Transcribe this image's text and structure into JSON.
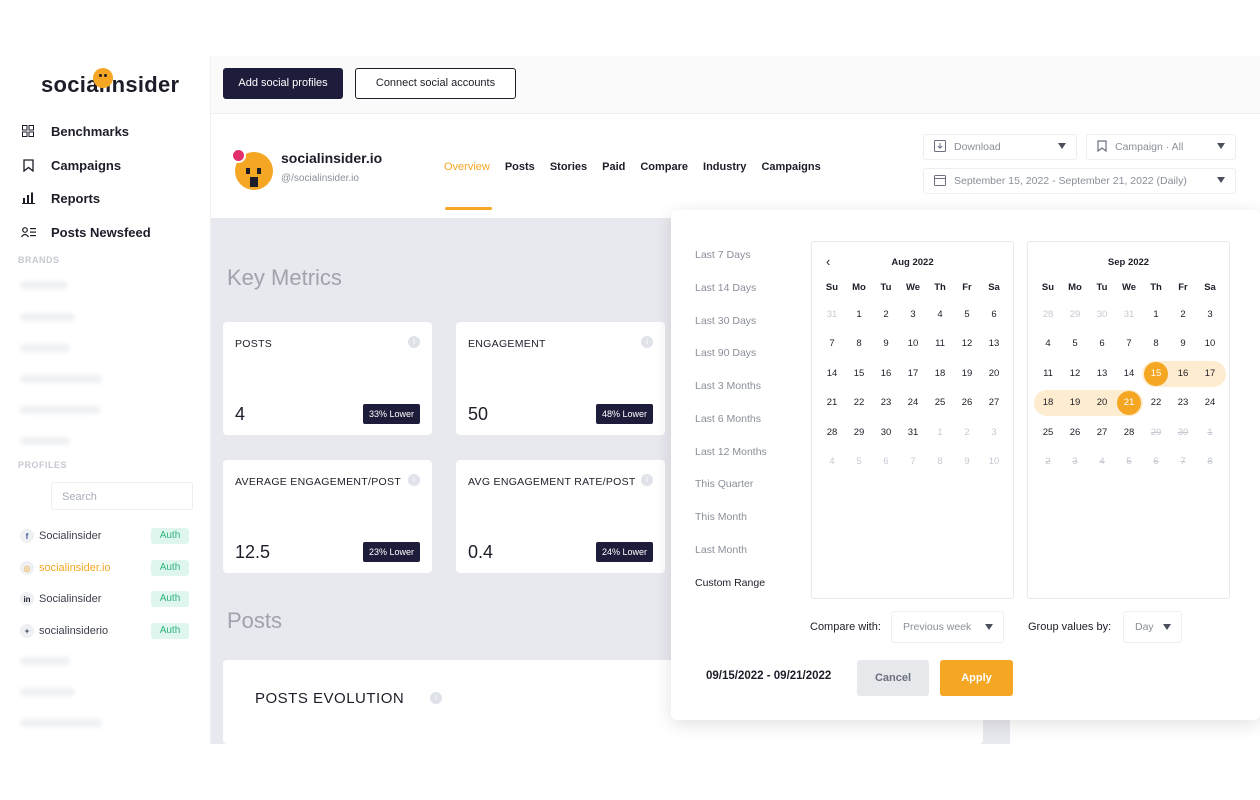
{
  "sidebar": {
    "logo": "socialinsider",
    "nav": [
      {
        "label": "Benchmarks",
        "icon": "grid-icon"
      },
      {
        "label": "Campaigns",
        "icon": "bookmark-icon"
      },
      {
        "label": "Reports",
        "icon": "bar-chart-icon"
      },
      {
        "label": "Posts Newsfeed",
        "icon": "newsfeed-icon"
      }
    ],
    "brands_label": "BRANDS",
    "profiles_label": "PROFILES",
    "search_placeholder": "Search",
    "profiles": [
      {
        "name": "Socialinsider",
        "network": "f",
        "auth": "Auth"
      },
      {
        "name": "socialinsider.io",
        "network": "ig",
        "auth": "Auth"
      },
      {
        "name": "Socialinsider",
        "network": "in",
        "auth": "Auth"
      },
      {
        "name": "socialinsiderio",
        "network": "tw",
        "auth": "Auth"
      }
    ]
  },
  "topbar": {
    "add_profiles": "Add social profiles",
    "connect_accounts": "Connect social accounts"
  },
  "header": {
    "brand_name": "socialinsider.io",
    "handle": "@/socialinsider.io",
    "tabs": [
      "Overview",
      "Posts",
      "Stories",
      "Paid",
      "Compare",
      "Industry",
      "Campaigns"
    ],
    "download_label": "Download",
    "campaign_label": "Campaign · All",
    "date_range_label": "September 15, 2022 - September 21, 2022 (Daily)"
  },
  "main": {
    "key_metrics_title": "Key Metrics",
    "cards": [
      {
        "title": "POSTS",
        "value": "4",
        "badge": "33% Lower"
      },
      {
        "title": "ENGAGEMENT",
        "value": "50",
        "badge": "48% Lower"
      },
      {
        "title": "AVERAGE ENGAGEMENT/POST",
        "value": "12.5",
        "badge": "23% Lower"
      },
      {
        "title": "AVG ENGAGEMENT RATE/POST",
        "value": "0.4",
        "badge": "24% Lower"
      }
    ],
    "posts_title": "Posts",
    "posts_evolution_title": "POSTS EVOLUTION"
  },
  "datepicker": {
    "presets": [
      "Last 7 Days",
      "Last 14 Days",
      "Last 30 Days",
      "Last 90 Days",
      "Last 3 Months",
      "Last 6 Months",
      "Last 12 Months",
      "This Quarter",
      "This Month",
      "Last Month",
      "Custom Range"
    ],
    "active_preset": "Custom Range",
    "dow": [
      "Su",
      "Mo",
      "Tu",
      "We",
      "Th",
      "Fr",
      "Sa"
    ],
    "calendars": [
      {
        "month": "Aug 2022",
        "weeks": [
          [
            "31",
            "1",
            "2",
            "3",
            "4",
            "5",
            "6"
          ],
          [
            "7",
            "8",
            "9",
            "10",
            "11",
            "12",
            "13"
          ],
          [
            "14",
            "15",
            "16",
            "17",
            "18",
            "19",
            "20"
          ],
          [
            "21",
            "22",
            "23",
            "24",
            "25",
            "26",
            "27"
          ],
          [
            "28",
            "29",
            "30",
            "31",
            "1",
            "2",
            "3"
          ],
          [
            "4",
            "5",
            "6",
            "7",
            "8",
            "9",
            "10"
          ]
        ]
      },
      {
        "month": "Sep 2022",
        "weeks": [
          [
            "28",
            "29",
            "30",
            "31",
            "1",
            "2",
            "3"
          ],
          [
            "4",
            "5",
            "6",
            "7",
            "8",
            "9",
            "10"
          ],
          [
            "11",
            "12",
            "13",
            "14",
            "15",
            "16",
            "17"
          ],
          [
            "18",
            "19",
            "20",
            "21",
            "22",
            "23",
            "24"
          ],
          [
            "25",
            "26",
            "27",
            "28",
            "29",
            "30",
            "1"
          ],
          [
            "2",
            "3",
            "4",
            "5",
            "6",
            "7",
            "8"
          ]
        ]
      }
    ],
    "compare_with_label": "Compare with:",
    "compare_with_value": "Previous week",
    "group_by_label": "Group values by:",
    "group_by_value": "Day",
    "range_text": "09/15/2022 - 09/21/2022",
    "cancel": "Cancel",
    "apply": "Apply",
    "accent_color": "#f5a623"
  }
}
